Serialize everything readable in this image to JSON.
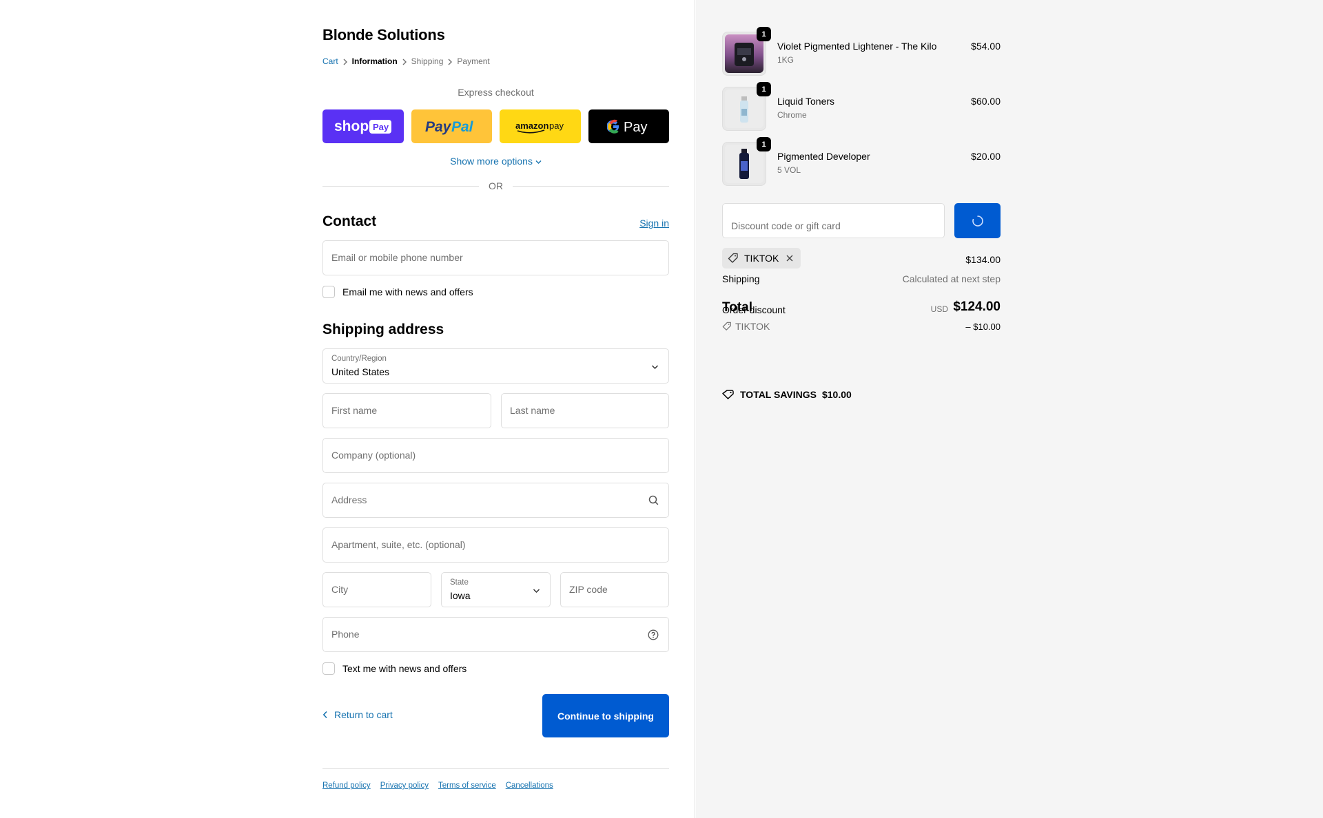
{
  "shop": {
    "name": "Blonde Solutions"
  },
  "breadcrumb": [
    {
      "label": "Cart"
    },
    {
      "label": "Information"
    },
    {
      "label": "Shipping"
    },
    {
      "label": "Payment"
    }
  ],
  "express": {
    "title": "Express checkout",
    "buttons": [
      "Shop Pay",
      "PayPal",
      "Amazon Pay",
      "Google Pay"
    ],
    "more_options": "Show more options",
    "or": "OR"
  },
  "contact": {
    "title": "Contact",
    "sign_in": "Sign in",
    "email_placeholder": "Email or mobile phone number",
    "news_checkbox": "Email me with news and offers"
  },
  "shipping": {
    "title": "Shipping address",
    "country_label": "Country/Region",
    "country_value": "United States",
    "first_name": "First name",
    "last_name": "Last name",
    "company": "Company (optional)",
    "address": "Address",
    "apartment": "Apartment, suite, etc. (optional)",
    "city": "City",
    "state_label": "State",
    "state_value": "Iowa",
    "zip": "ZIP code",
    "phone": "Phone",
    "text_checkbox": "Text me with news and offers"
  },
  "actions": {
    "return": "Return to cart",
    "continue": "Continue to shipping"
  },
  "footer": [
    "Refund policy",
    "Privacy policy",
    "Terms of service",
    "Cancellations"
  ],
  "cart": {
    "items": [
      {
        "name": "Violet Pigmented Lightener - The Kilo",
        "variant": "1KG",
        "price": "$54.00",
        "qty": "1"
      },
      {
        "name": "Liquid Toners",
        "variant": "Chrome",
        "price": "$60.00",
        "qty": "1"
      },
      {
        "name": "Pigmented Developer",
        "variant": "5 VOL",
        "price": "$20.00",
        "qty": "1"
      }
    ],
    "discount_placeholder": "Discount code or gift card",
    "applied_code": "TIKTOK",
    "subtotal_value": "$134.00",
    "shipping_label": "Shipping",
    "shipping_value": "Calculated at next step",
    "total_label": "Total",
    "currency": "USD",
    "total_value": "$124.00",
    "order_discount_label": "Order discount",
    "discount_code": "TIKTOK",
    "discount_value": "– $10.00",
    "savings_label": "TOTAL SAVINGS",
    "savings_value": "$10.00"
  },
  "colors": {
    "accent": "#005bd1",
    "link": "#1773b0",
    "shop_pay": "#5a31f4",
    "paypal": "#ffc439",
    "amazon": "#ffd814"
  }
}
